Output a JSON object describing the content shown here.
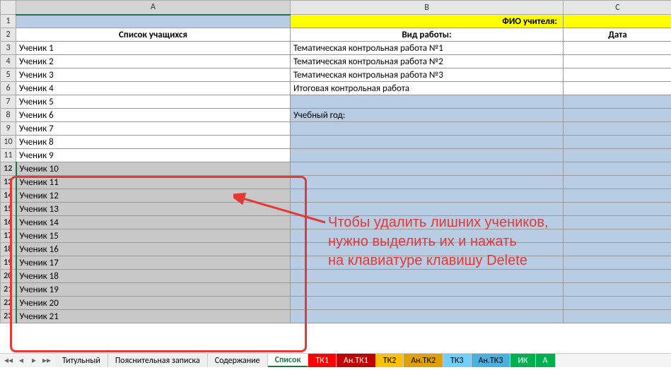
{
  "columns": {
    "A": "A",
    "B": "B",
    "C": "C"
  },
  "row1": {
    "b": "ФИО учителя:"
  },
  "headers": {
    "a": "Список учащихся",
    "b": "Вид работы:",
    "c": "Дата"
  },
  "colA": [
    "Ученик 1",
    "Ученик 2",
    "Ученик 3",
    "Ученик 4",
    "Ученик 5",
    "Ученик 6",
    "Ученик 7",
    "Ученик 8",
    "Ученик 9",
    "Ученик 10",
    "Ученик 11",
    "Ученик 12",
    "Ученик 13",
    "Ученик 14",
    "Ученик 15",
    "Ученик 16",
    "Ученик 17",
    "Ученик 18",
    "Ученик 19",
    "Ученик 20",
    "Ученик 21"
  ],
  "colB": {
    "3": "Тематическая контрольная работа №1",
    "4": "Тематическая контрольная работа №2",
    "5": "Тематическая контрольная работа №3",
    "6": "Итоговая контрольная работа",
    "8": "Учебный год:"
  },
  "annotation": "Чтобы удалить лишних учеников,\nнужно выделить их и нажать\nна клавиатуре клавишу Delete",
  "tabs": {
    "nav_prev_all": "◂◂",
    "nav_prev": "◂",
    "nav_next": "▸",
    "nav_next_all": "▸▸",
    "items": [
      {
        "label": "Титульный",
        "cls": ""
      },
      {
        "label": "Пояснительная записка",
        "cls": ""
      },
      {
        "label": "Содержание",
        "cls": ""
      },
      {
        "label": "Список",
        "cls": "active"
      },
      {
        "label": "ТК1",
        "cls": "red"
      },
      {
        "label": "Ан.ТК1",
        "cls": "darkred"
      },
      {
        "label": "ТК2",
        "cls": "orange"
      },
      {
        "label": "Ан.ТК2",
        "cls": "darkorg"
      },
      {
        "label": "ТК3",
        "cls": "cyan"
      },
      {
        "label": "Ан.ТК3",
        "cls": "darkcyan"
      },
      {
        "label": "ИК",
        "cls": "green"
      },
      {
        "label": "А",
        "cls": "green"
      }
    ]
  },
  "selection": {
    "startRow": 12,
    "endRow": 23
  }
}
